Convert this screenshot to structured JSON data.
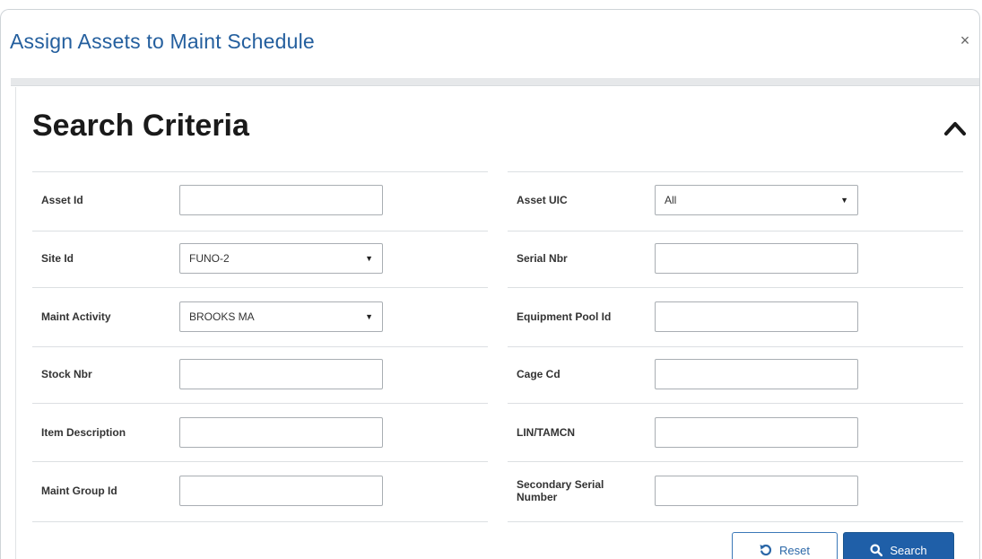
{
  "dialog": {
    "title": "Assign Assets to Maint Schedule",
    "close_symbol": "×"
  },
  "panel": {
    "title": "Search Criteria",
    "collapse_icon": "chevron-up-icon"
  },
  "left_fields": [
    {
      "label": "Asset Id",
      "type": "text",
      "value": ""
    },
    {
      "label": "Site Id",
      "type": "select",
      "value": "FUNO-2"
    },
    {
      "label": "Maint Activity",
      "type": "select",
      "value": "BROOKS MA"
    },
    {
      "label": "Stock Nbr",
      "type": "text",
      "value": ""
    },
    {
      "label": "Item Description",
      "type": "text",
      "value": ""
    },
    {
      "label": "Maint Group Id",
      "type": "text",
      "value": ""
    }
  ],
  "right_fields": [
    {
      "label": "Asset UIC",
      "type": "select",
      "value": "All"
    },
    {
      "label": "Serial Nbr",
      "type": "text",
      "value": ""
    },
    {
      "label": "Equipment Pool Id",
      "type": "text",
      "value": ""
    },
    {
      "label": "Cage Cd",
      "type": "text",
      "value": ""
    },
    {
      "label": "LIN/TAMCN",
      "type": "text",
      "value": ""
    },
    {
      "label": "Secondary Serial Number",
      "type": "text",
      "value": ""
    }
  ],
  "actions": {
    "reset_label": "Reset",
    "search_label": "Search"
  },
  "colors": {
    "title": "#245f9e",
    "primary": "#1f5fa8",
    "border": "#a9aeb3"
  }
}
